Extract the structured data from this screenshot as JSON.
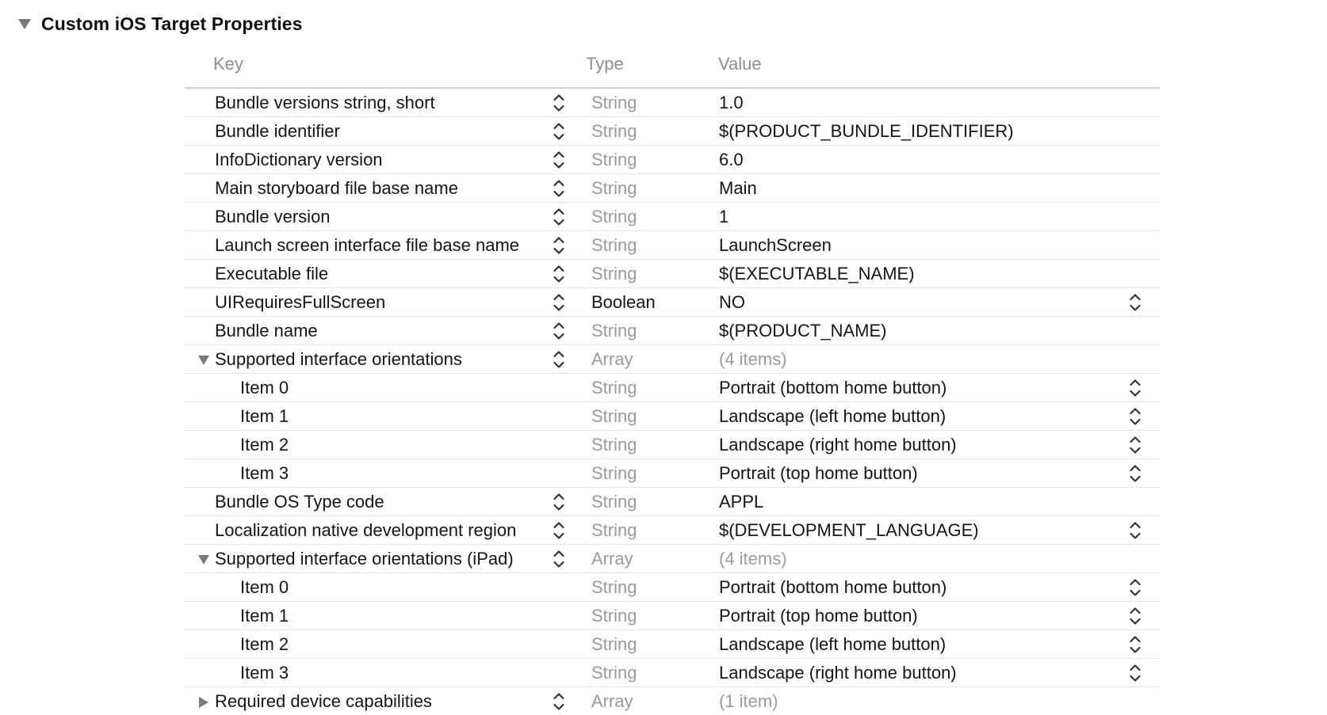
{
  "section": {
    "title": "Custom iOS Target Properties",
    "expanded": true
  },
  "columns": {
    "key": "Key",
    "type": "Type",
    "value": "Value"
  },
  "rows": [
    {
      "key": "Bundle versions string, short",
      "type": "String",
      "value": "1.0",
      "level": 0,
      "key_stepper": true,
      "value_stepper": false
    },
    {
      "key": "Bundle identifier",
      "type": "String",
      "value": "$(PRODUCT_BUNDLE_IDENTIFIER)",
      "level": 0,
      "key_stepper": true,
      "value_stepper": false
    },
    {
      "key": "InfoDictionary version",
      "type": "String",
      "value": "6.0",
      "level": 0,
      "key_stepper": true,
      "value_stepper": false
    },
    {
      "key": "Main storyboard file base name",
      "type": "String",
      "value": "Main",
      "level": 0,
      "key_stepper": true,
      "value_stepper": false
    },
    {
      "key": "Bundle version",
      "type": "String",
      "value": "1",
      "level": 0,
      "key_stepper": true,
      "value_stepper": false
    },
    {
      "key": "Launch screen interface file base name",
      "type": "String",
      "value": "LaunchScreen",
      "level": 0,
      "key_stepper": true,
      "value_stepper": false
    },
    {
      "key": "Executable file",
      "type": "String",
      "value": "$(EXECUTABLE_NAME)",
      "level": 0,
      "key_stepper": true,
      "value_stepper": false
    },
    {
      "key": "UIRequiresFullScreen",
      "type": "Boolean",
      "value": "NO",
      "level": 0,
      "key_stepper": true,
      "value_stepper": true,
      "type_dark": true
    },
    {
      "key": "Bundle name",
      "type": "String",
      "value": "$(PRODUCT_NAME)",
      "level": 0,
      "key_stepper": true,
      "value_stepper": false
    },
    {
      "key": "Supported interface orientations",
      "type": "Array",
      "value": "(4 items)",
      "level": 0,
      "key_stepper": true,
      "value_stepper": false,
      "disclosure": "expanded",
      "value_muted": true
    },
    {
      "key": "Item 0",
      "type": "String",
      "value": "Portrait (bottom home button)",
      "level": 1,
      "key_stepper": false,
      "value_stepper": true
    },
    {
      "key": "Item 1",
      "type": "String",
      "value": "Landscape (left home button)",
      "level": 1,
      "key_stepper": false,
      "value_stepper": true
    },
    {
      "key": "Item 2",
      "type": "String",
      "value": "Landscape (right home button)",
      "level": 1,
      "key_stepper": false,
      "value_stepper": true
    },
    {
      "key": "Item 3",
      "type": "String",
      "value": "Portrait (top home button)",
      "level": 1,
      "key_stepper": false,
      "value_stepper": true
    },
    {
      "key": "Bundle OS Type code",
      "type": "String",
      "value": "APPL",
      "level": 0,
      "key_stepper": true,
      "value_stepper": false
    },
    {
      "key": "Localization native development region",
      "type": "String",
      "value": "$(DEVELOPMENT_LANGUAGE)",
      "level": 0,
      "key_stepper": true,
      "value_stepper": true
    },
    {
      "key": "Supported interface orientations (iPad)",
      "type": "Array",
      "value": "(4 items)",
      "level": 0,
      "key_stepper": true,
      "value_stepper": false,
      "disclosure": "expanded",
      "value_muted": true
    },
    {
      "key": "Item 0",
      "type": "String",
      "value": "Portrait (bottom home button)",
      "level": 1,
      "key_stepper": false,
      "value_stepper": true
    },
    {
      "key": "Item 1",
      "type": "String",
      "value": "Portrait (top home button)",
      "level": 1,
      "key_stepper": false,
      "value_stepper": true
    },
    {
      "key": "Item 2",
      "type": "String",
      "value": "Landscape (left home button)",
      "level": 1,
      "key_stepper": false,
      "value_stepper": true
    },
    {
      "key": "Item 3",
      "type": "String",
      "value": "Landscape (right home button)",
      "level": 1,
      "key_stepper": false,
      "value_stepper": true
    },
    {
      "key": "Required device capabilities",
      "type": "Array",
      "value": "(1 item)",
      "level": 0,
      "key_stepper": true,
      "value_stepper": false,
      "disclosure": "collapsed",
      "value_muted": true
    }
  ],
  "icons": {
    "disclosure_expanded": "disclosure-triangle-down-icon",
    "disclosure_collapsed": "disclosure-triangle-right-icon",
    "stepper": "up-down-chevron-icon"
  },
  "colors": {
    "text": "#151515",
    "muted": "#9a9a9a",
    "triangle": "#7a7a7a",
    "divider": "#e4e4e4"
  }
}
